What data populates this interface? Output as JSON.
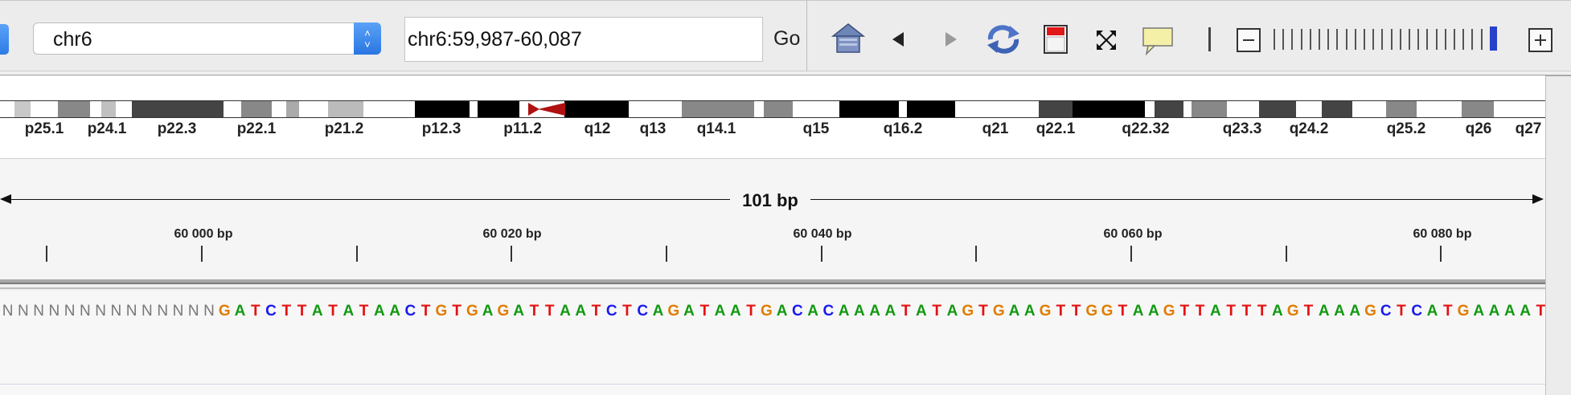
{
  "toolbar": {
    "chromosome_select": "chr6",
    "locus": "chr6:59,987-60,087",
    "go_label": "Go",
    "icons": [
      "home-icon",
      "back-icon",
      "forward-icon",
      "refresh-icon",
      "region-of-interest-icon",
      "fit-to-window-icon",
      "popup-info-icon",
      "ruler-divider-icon",
      "zoom-out-icon",
      "zoom-slider",
      "zoom-in-icon"
    ]
  },
  "ideogram": {
    "band_labels": [
      "p25.1",
      "p24.1",
      "p22.3",
      "p22.1",
      "p21.2",
      "p12.3",
      "p11.2",
      "q12",
      "q13",
      "q14.1",
      "q15",
      "q16.2",
      "q21",
      "q22.1",
      "q22.32",
      "q23.3",
      "q24.2",
      "q25.2",
      "q26",
      "q27"
    ],
    "centromere_color": "#b01010"
  },
  "ruler": {
    "span_label": "101 bp",
    "tick_labels": [
      "60 000 bp",
      "60 020 bp",
      "60 040 bp",
      "60 060 bp",
      "60 080 bp"
    ]
  },
  "sequence": {
    "bases": "NNNNNNNNNNNNNNGATCTTATATAACTGTGAGATTAATCTCAGATAATGACACAAAATATAGTGAAGTTGGTAAGTTATTTAGTAAAGCTCATGAAAATT",
    "colors": {
      "A": "#119911",
      "C": "#1a1aee",
      "G": "#e07c00",
      "T": "#e41010",
      "N": "#777777"
    }
  }
}
